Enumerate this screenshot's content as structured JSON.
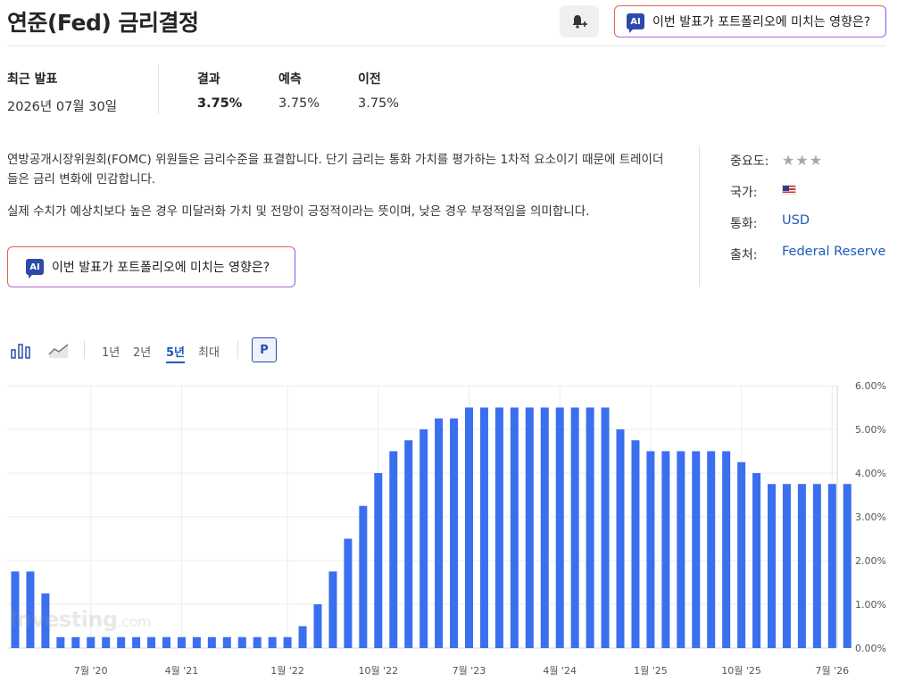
{
  "header": {
    "title": "연준(Fed) 금리결정",
    "ai_button_label": "이번 발표가 포트폴리오에 미치는 영향은?",
    "ai_badge": "AI"
  },
  "release": {
    "date_label": "최근 발표",
    "date_value": "2026년 07월 30일",
    "actual_label": "결과",
    "actual_value": "3.75%",
    "forecast_label": "예측",
    "forecast_value": "3.75%",
    "previous_label": "이전",
    "previous_value": "3.75%"
  },
  "description": {
    "p1": "연방공개시장위원회(FOMC) 위원들은 금리수준을 표결합니다. 단기 금리는 통화 가치를 평가하는 1차적 요소이기 때문에 트레이더들은 금리 변화에 민감합니다.",
    "p2": "실제 수치가 예상치보다 높은 경우 미달러화 가치 및 전망이 긍정적이라는 뜻이며, 낮은 경우 부정적임을 의미합니다.",
    "ai_button_label": "이번 발표가 포트폴리오에 미치는 영향은?"
  },
  "info": {
    "importance_label": "중요도:",
    "importance_stars": "★★★",
    "country_label": "국가:",
    "currency_label": "통화:",
    "currency_value": "USD",
    "source_label": "출처:",
    "source_value": "Federal Reserve"
  },
  "controls": {
    "ranges": [
      "1년",
      "2년",
      "5년",
      "최대"
    ],
    "active_range": "5년",
    "p_button": "P"
  },
  "colors": {
    "bar": "#3a6ff0",
    "link": "#1e5bb8"
  },
  "watermark": {
    "brand": "Investing",
    "suffix": ".com"
  },
  "chart_data": {
    "type": "bar",
    "ylim": [
      0,
      6
    ],
    "y_ticks": [
      "0.00%",
      "1.00%",
      "2.00%",
      "3.00%",
      "4.00%",
      "5.00%",
      "6.00%"
    ],
    "x_tick_labels": [
      {
        "index": 5,
        "label": "7월 '20"
      },
      {
        "index": 11,
        "label": "4월 '21"
      },
      {
        "index": 18,
        "label": "1월 '22"
      },
      {
        "index": 24,
        "label": "10월 '22"
      },
      {
        "index": 30,
        "label": "7월 '23"
      },
      {
        "index": 36,
        "label": "4월 '24"
      },
      {
        "index": 42,
        "label": "1월 '25"
      },
      {
        "index": 48,
        "label": "10월 '25"
      },
      {
        "index": 54,
        "label": "7월 '26"
      }
    ],
    "values": [
      1.75,
      1.75,
      1.25,
      0.25,
      0.25,
      0.25,
      0.25,
      0.25,
      0.25,
      0.25,
      0.25,
      0.25,
      0.25,
      0.25,
      0.25,
      0.25,
      0.25,
      0.25,
      0.25,
      0.5,
      1.0,
      1.75,
      2.5,
      3.25,
      4.0,
      4.5,
      4.75,
      5.0,
      5.25,
      5.25,
      5.5,
      5.5,
      5.5,
      5.5,
      5.5,
      5.5,
      5.5,
      5.5,
      5.5,
      5.5,
      5.0,
      4.75,
      4.5,
      4.5,
      4.5,
      4.5,
      4.5,
      4.5,
      4.25,
      4.0,
      3.75,
      3.75,
      3.75,
      3.75,
      3.75,
      3.75
    ]
  }
}
